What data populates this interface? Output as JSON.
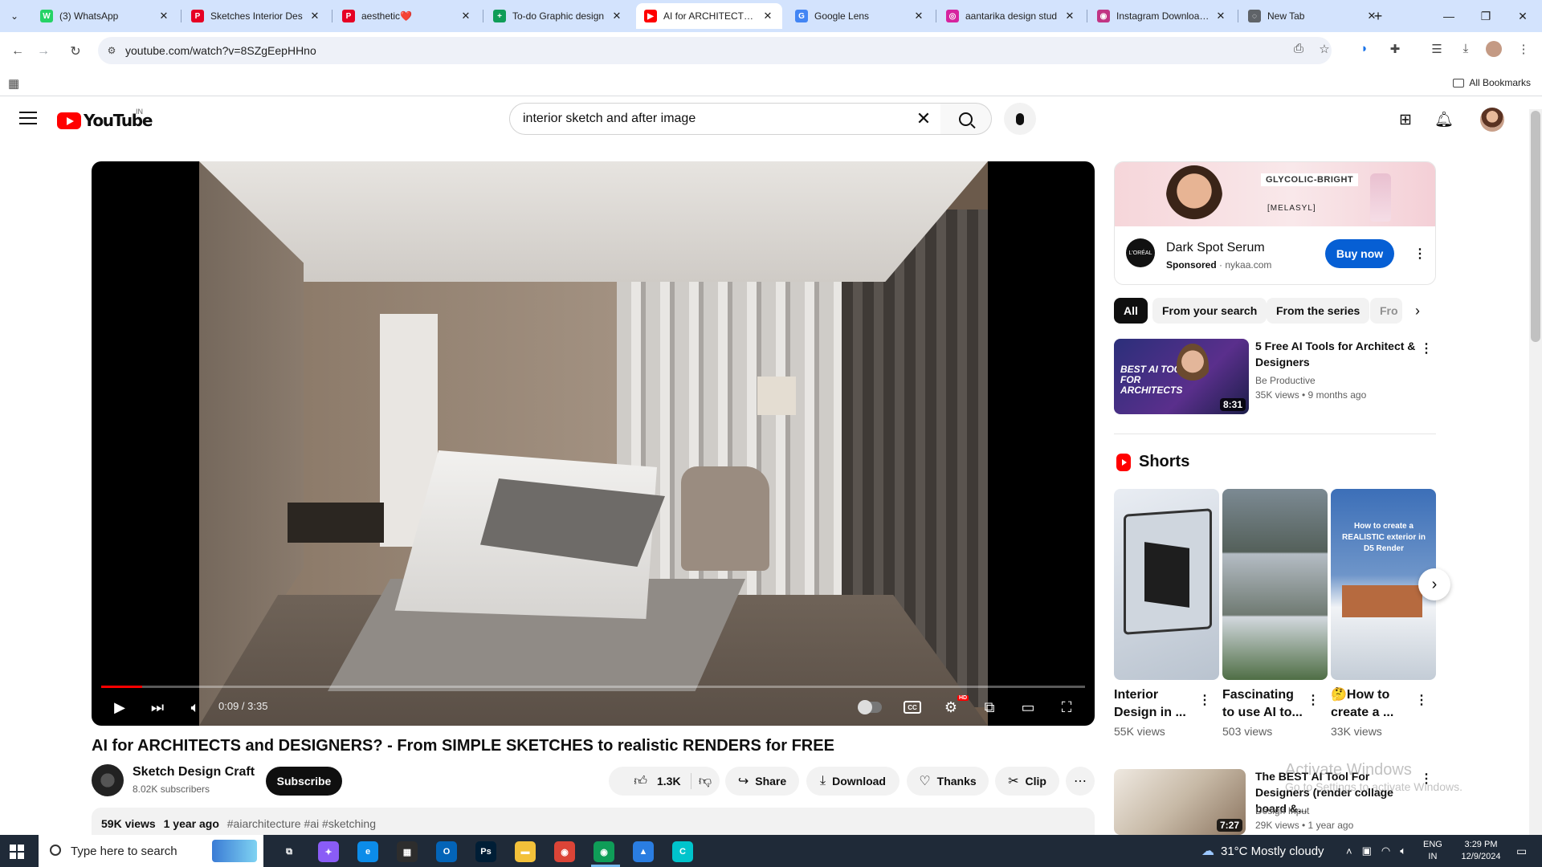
{
  "browser": {
    "tabs": [
      {
        "title": "(3) WhatsApp",
        "color": "#25d366",
        "glyph": "W"
      },
      {
        "title": "Sketches Interior Des",
        "color": "#e60023",
        "glyph": "P"
      },
      {
        "title": "aesthetic❤️",
        "color": "#e60023",
        "glyph": "P"
      },
      {
        "title": "To-do Graphic design",
        "color": "#0f9d58",
        "glyph": "+"
      },
      {
        "title": "AI for ARCHITECTS an",
        "color": "#ff0000",
        "glyph": "▶"
      },
      {
        "title": "Google Lens",
        "color": "#4285f4",
        "glyph": "G"
      },
      {
        "title": "aantarika design stud",
        "color": "#d6249f",
        "glyph": "◎"
      },
      {
        "title": "Instagram Downloade",
        "color": "#c13584",
        "glyph": "◉"
      },
      {
        "title": "New Tab",
        "color": "#5f6368",
        "glyph": "◌"
      }
    ],
    "active_tab": 4,
    "url": "youtube.com/watch?v=8SZgEepHHno",
    "all_bookmarks": "All Bookmarks"
  },
  "youtube": {
    "logo_text": "YouTube",
    "country_code": "IN",
    "search_value": "interior sketch and after image",
    "player": {
      "time": "0:09 / 3:35",
      "progress_fraction": 0.042
    },
    "video": {
      "title": "AI for ARCHITECTS and DESIGNERS? - From SIMPLE SKETCHES to realistic RENDERS for FREE",
      "channel": "Sketch Design Craft",
      "subscribers": "8.02K subscribers",
      "subscribe_label": "Subscribe",
      "likes": "1.3K",
      "share_label": "Share",
      "download_label": "Download",
      "thanks_label": "Thanks",
      "clip_label": "Clip",
      "views": "59K views",
      "age": "1 year ago",
      "tags": "#aiarchitecture #ai #sketching"
    },
    "ad": {
      "brand_line1": "GLYCOLIC-BRIGHT",
      "brand_line2": "[MELASYL]",
      "logo_text": "L'ORÉAL",
      "title": "Dark Spot Serum",
      "sponsored": "Sponsored",
      "domain": "nykaa.com",
      "cta": "Buy now"
    },
    "chips": [
      "All",
      "From your search",
      "From the series",
      "Fro"
    ],
    "recommendations": [
      {
        "title": "5 Free AI Tools for Architect & Designers",
        "channel": "Be Productive",
        "meta": "35K views • 9 months ago",
        "duration": "8:31",
        "thumb_text": "BEST AI TOOLS FOR ARCHITECTS"
      },
      {
        "title": "The BEST AI Tool For Designers (render collage board &...",
        "channel": "Design Input",
        "meta": "29K views • 1 year ago",
        "duration": "7:27"
      }
    ],
    "shorts_label": "Shorts",
    "shorts": [
      {
        "title": "Interior Design in ...",
        "views": "55K views"
      },
      {
        "title": "Fascinating to use AI to...",
        "views": "503 views"
      },
      {
        "title": "🤔How to create a ...",
        "views": "33K views",
        "thumb_text": "How to create a REALISTIC exterior in D5 Render"
      }
    ],
    "watermark_line1": "Activate Windows",
    "watermark_line2": "Go to Settings to activate Windows."
  },
  "taskbar": {
    "search_placeholder": "Type here to search",
    "weather": "31°C  Mostly cloudy",
    "lang": "ENG",
    "region": "IN",
    "time": "3:29 PM",
    "date": "12/9/2024",
    "apps": [
      {
        "name": "task-view",
        "glyph": "⧉",
        "color": "transparent"
      },
      {
        "name": "copilot",
        "glyph": "✦",
        "color": "#8a5cf6"
      },
      {
        "name": "edge",
        "glyph": "e",
        "color": "#0c8ce9"
      },
      {
        "name": "store",
        "glyph": "▦",
        "color": "#2d2d2d"
      },
      {
        "name": "outlook",
        "glyph": "O",
        "color": "#0364b8"
      },
      {
        "name": "photoshop",
        "glyph": "Ps",
        "color": "#001e36"
      },
      {
        "name": "file-explorer",
        "glyph": "▬",
        "color": "#f3c13a"
      },
      {
        "name": "chrome",
        "glyph": "◉",
        "color": "#db4437"
      },
      {
        "name": "chrome-profile",
        "glyph": "◉",
        "color": "#0f9d58"
      },
      {
        "name": "photos",
        "glyph": "▲",
        "color": "#2a7de1"
      },
      {
        "name": "canva",
        "glyph": "C",
        "color": "#00c4cc"
      }
    ]
  }
}
